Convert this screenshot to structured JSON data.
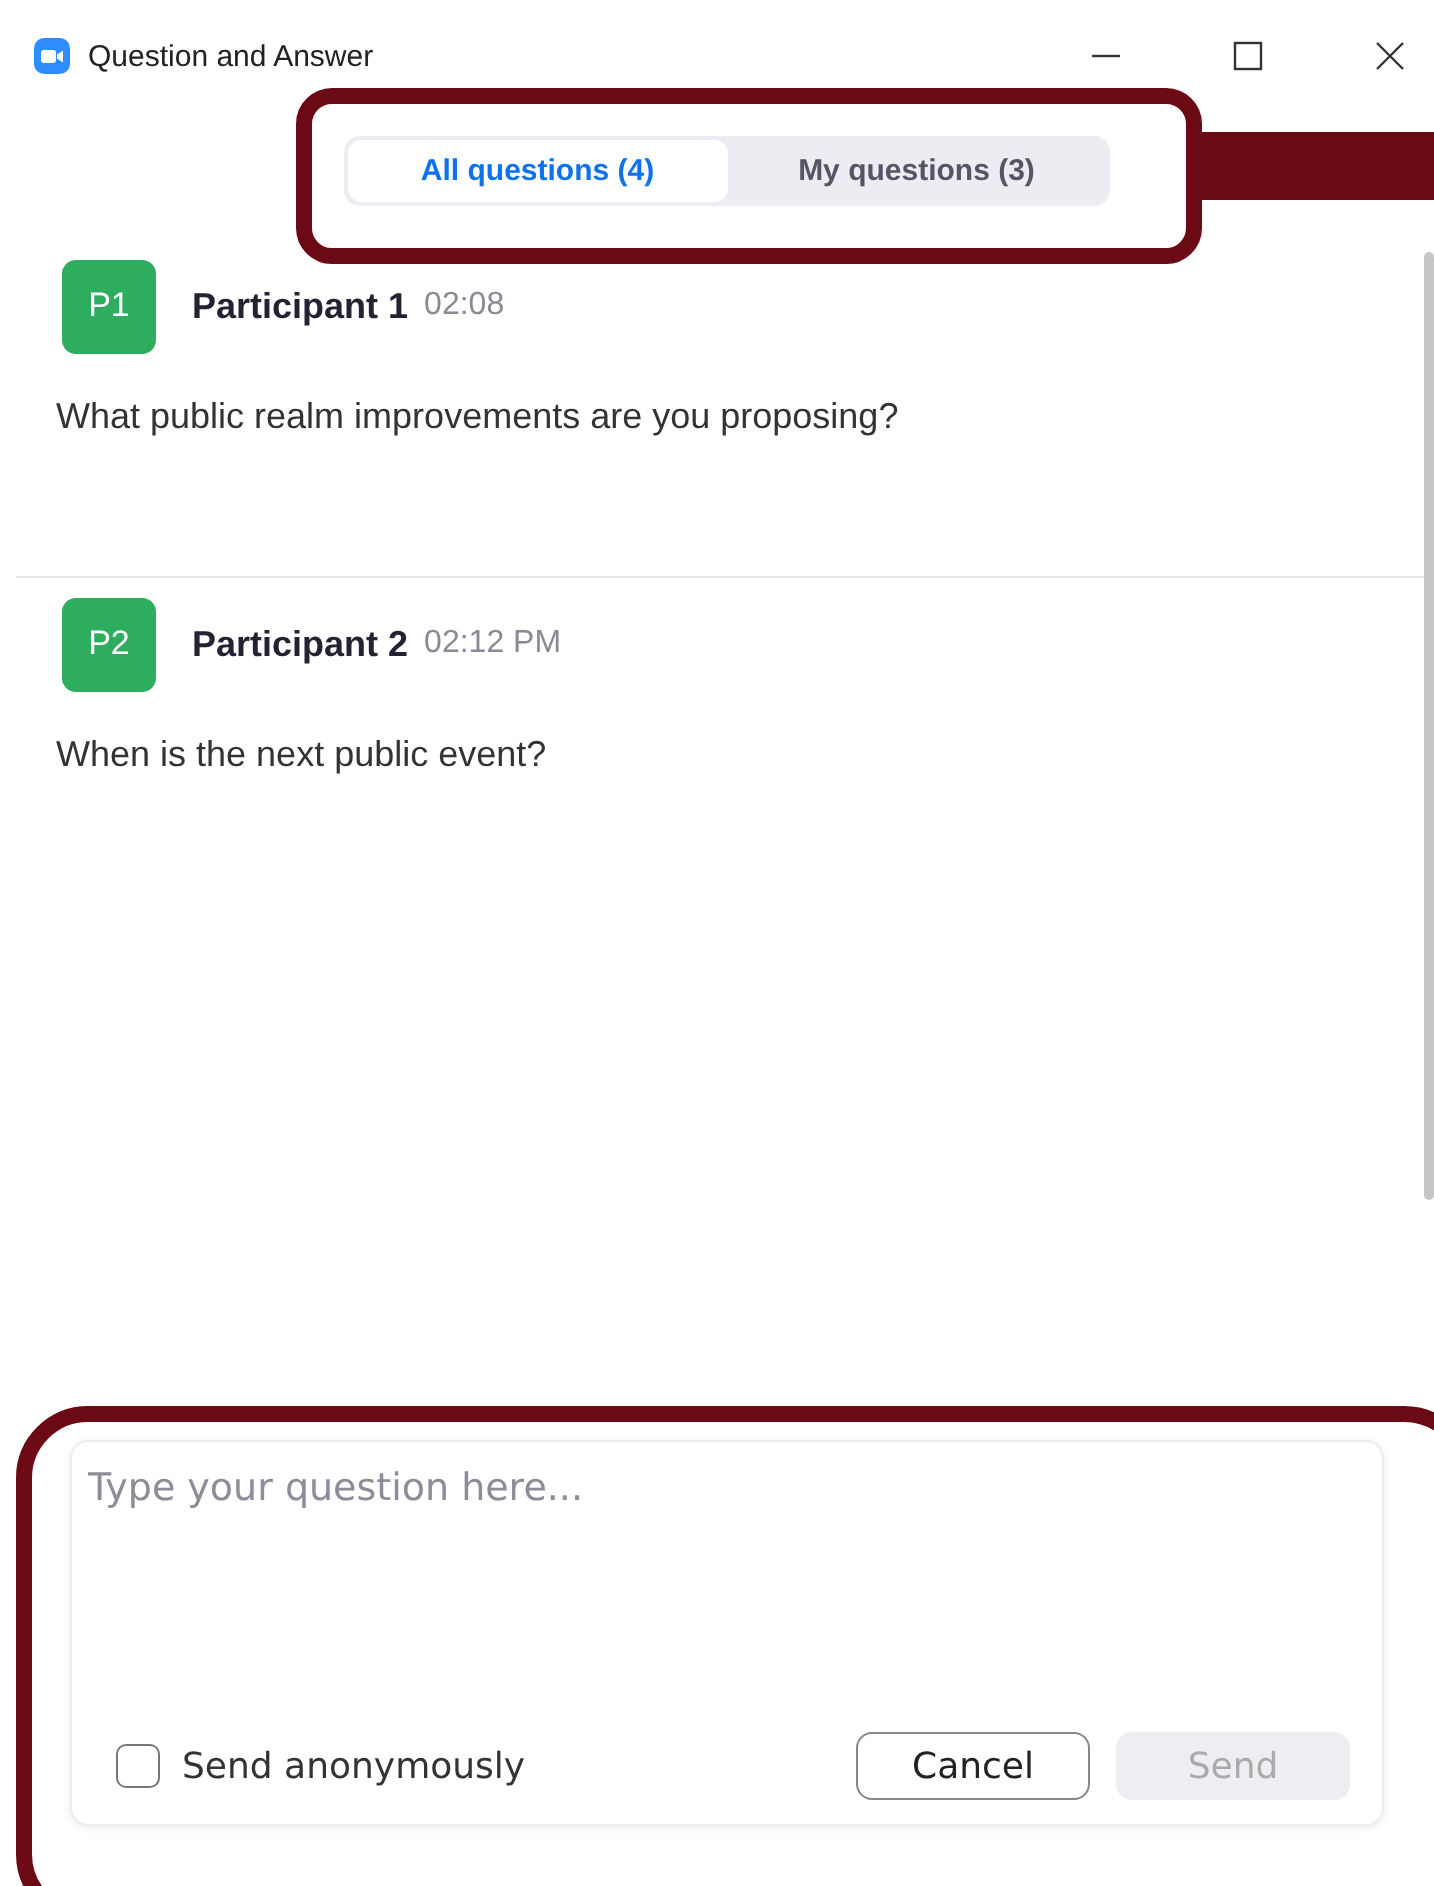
{
  "window": {
    "title": "Question and Answer"
  },
  "tabs": [
    {
      "label": "All questions (4)",
      "selected": true
    },
    {
      "label": "My questions (3)",
      "selected": false
    }
  ],
  "questions": [
    {
      "avatar": "P1",
      "name": "Participant 1",
      "time": "02:08",
      "text": "What public realm improvements are you proposing?"
    },
    {
      "avatar": "P2",
      "name": "Participant 2",
      "time": "02:12 PM",
      "text": "When is the next public event?"
    }
  ],
  "composer": {
    "placeholder": "Type your question here...",
    "anonymous": {
      "label": "Send anonymously",
      "checked": false
    },
    "buttons": [
      {
        "label": "Cancel",
        "disabled": false
      },
      {
        "label": "Send",
        "disabled": true
      }
    ]
  }
}
